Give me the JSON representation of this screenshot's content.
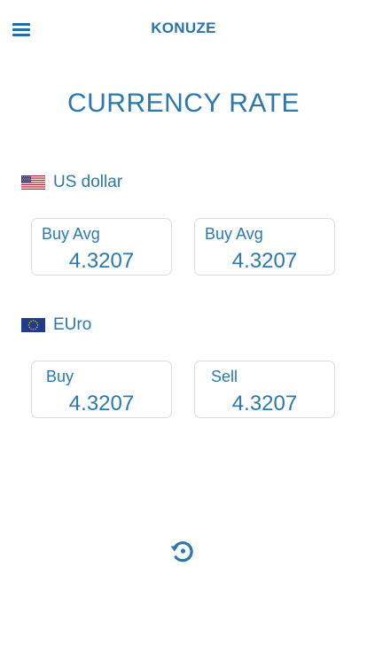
{
  "header": {
    "app_title": "KONUZE",
    "menu_icon": "hamburger-menu-icon"
  },
  "page": {
    "title": "CURRENCY RATE"
  },
  "currencies": [
    {
      "name": "US dollar",
      "flag_icon": "us-flag-icon",
      "cards": [
        {
          "label": "Buy Avg",
          "value": "4.3207"
        },
        {
          "label": "Buy Avg",
          "value": "4.3207"
        }
      ]
    },
    {
      "name": "EUro",
      "flag_icon": "eu-flag-icon",
      "cards": [
        {
          "label": "Buy",
          "value": "4.3207"
        },
        {
          "label": "Sell",
          "value": "4.3207"
        }
      ]
    }
  ],
  "footer": {
    "refresh_icon": "refresh-history-icon"
  },
  "colors": {
    "accent": "#2b78ad",
    "card_border": "#d9dde2",
    "us_flag_blue": "#3c3b6e",
    "us_flag_red": "#b22234",
    "eu_flag_blue": "#1f3b8a",
    "eu_flag_gold": "#ffcc00"
  }
}
